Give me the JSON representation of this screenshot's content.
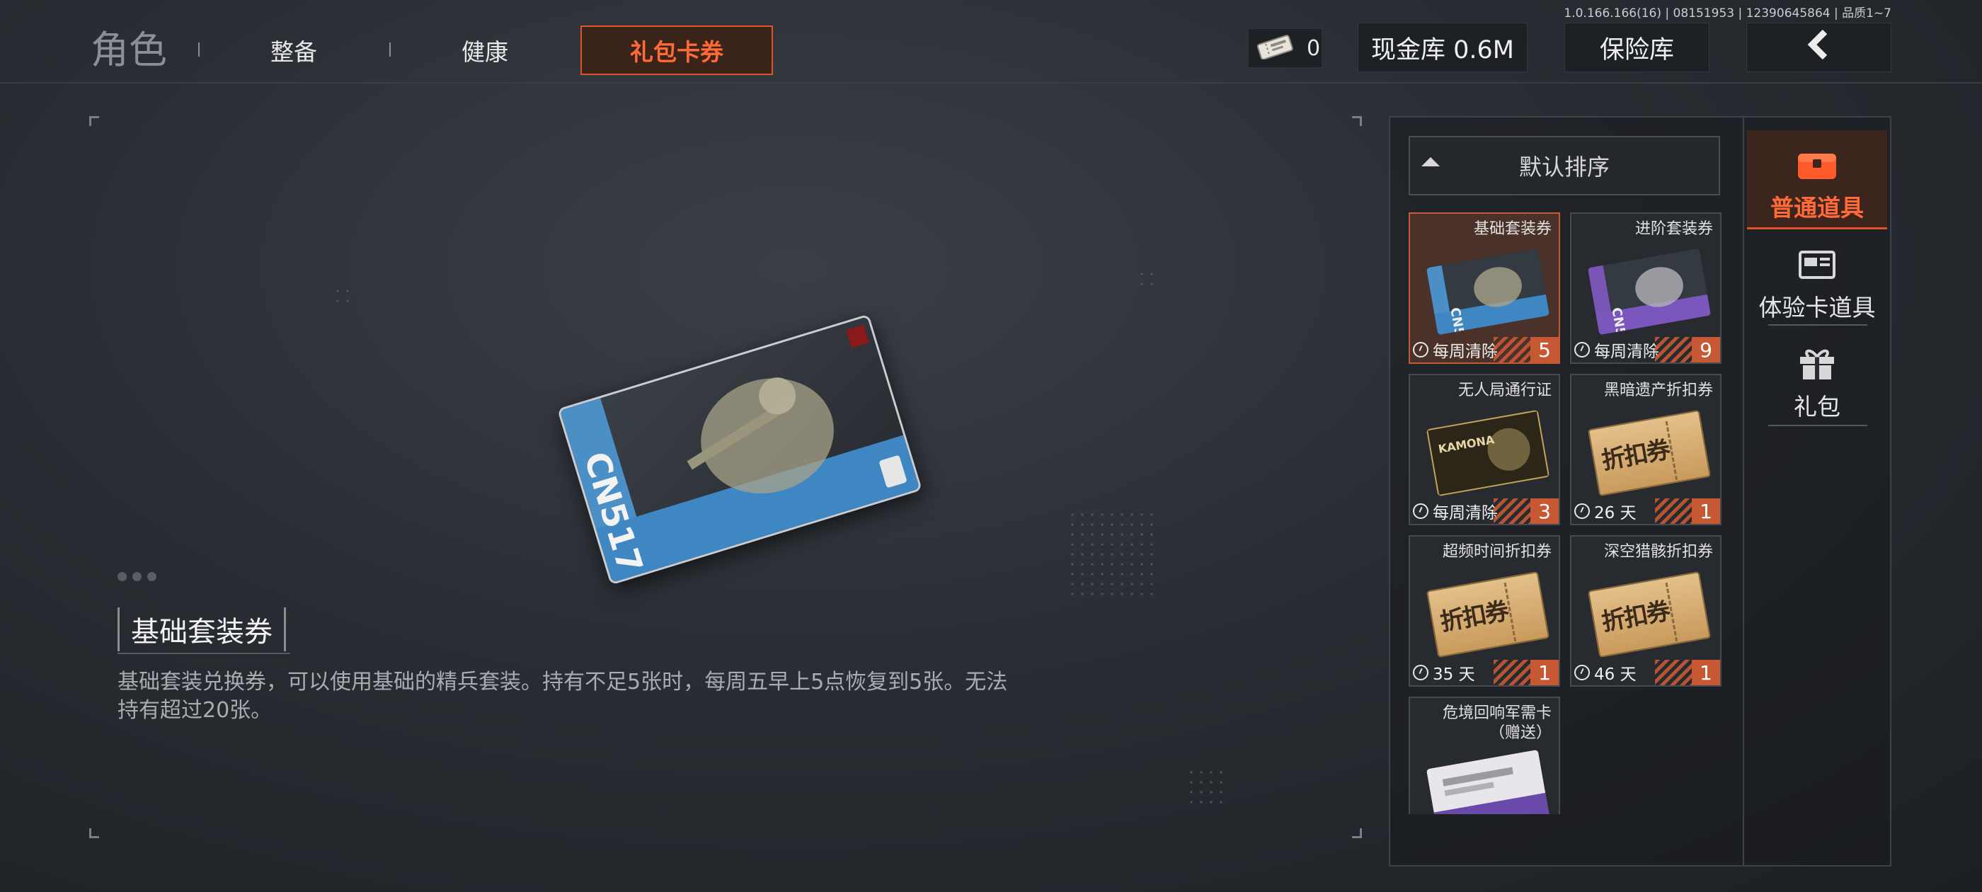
{
  "version_text": "1.0.166.166(16) | 08151953 | 12390645864 | 品质1~7",
  "tabs": [
    {
      "label": "角色",
      "active": false
    },
    {
      "label": "整备",
      "active": false
    },
    {
      "label": "健康",
      "active": false
    },
    {
      "label": "礼包卡券",
      "active": true
    }
  ],
  "header": {
    "ticket_count": "0",
    "cash_label": "现金库 0.6M",
    "safe_label": "保险库",
    "back_icon": "chevron-left-icon"
  },
  "detail": {
    "title": "基础套装券",
    "description": "基础套装兑换券，可以使用基础的精兵套装。持有不足5张时，每周五早上5点恢复到5张。无法持有超过20张。"
  },
  "sort": {
    "label": "默认排序"
  },
  "items": [
    {
      "name": "基础套装券",
      "footer": "每周清除",
      "count": "5",
      "selected": true,
      "thumb": "card-blue"
    },
    {
      "name": "进阶套装券",
      "footer": "每周清除",
      "count": "9",
      "selected": false,
      "thumb": "card-purple"
    },
    {
      "name": "无人局通行证",
      "footer": "每周清除",
      "count": "3",
      "selected": false,
      "thumb": "card-gold"
    },
    {
      "name": "黑暗遗产折扣券",
      "footer": "26 天",
      "count": "1",
      "selected": false,
      "thumb": "coupon"
    },
    {
      "name": "超频时间折扣券",
      "footer": "35 天",
      "count": "1",
      "selected": false,
      "thumb": "coupon"
    },
    {
      "name": "深空猎骸折扣券",
      "footer": "46 天",
      "count": "1",
      "selected": false,
      "thumb": "coupon"
    },
    {
      "name": "危境回响军需卡",
      "name2": "（赠送）",
      "footer": "",
      "count": "",
      "selected": false,
      "thumb": "card-white"
    }
  ],
  "coupon_text": "折扣券",
  "card_brand": "KAMONA",
  "card_code": "CN517",
  "categories": [
    {
      "label": "普通道具",
      "icon": "treasure-chest-icon",
      "active": true
    },
    {
      "label": "体验卡道具",
      "icon": "card-icon",
      "active": false
    },
    {
      "label": "礼包",
      "icon": "gift-icon",
      "active": false
    }
  ],
  "colors": {
    "accent": "#e0542a",
    "count_bg": "#c75834",
    "selected_bg": "#4a3129"
  }
}
